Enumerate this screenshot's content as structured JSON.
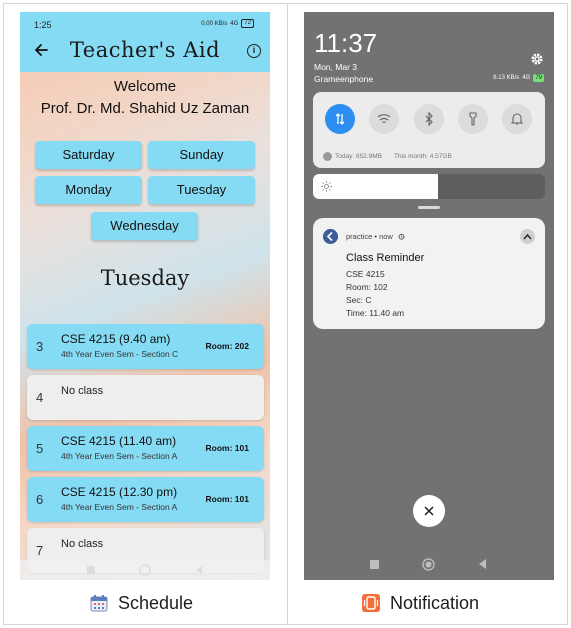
{
  "schedule_screen": {
    "status_time": "1:25",
    "status_net": "0.00 KB/s",
    "status_signal": "4G",
    "battery": "72",
    "app_title": "Teacher's Aid",
    "welcome": "Welcome",
    "teacher_name": "Prof. Dr. Md. Shahid Uz Zaman",
    "day_buttons": [
      "Saturday",
      "Sunday",
      "Monday",
      "Tuesday",
      "Wednesday"
    ],
    "selected_day": "Tuesday",
    "classes": [
      {
        "num": "3",
        "title": "CSE 4215 (9.40 am)",
        "sub": "4th Year Even Sem - Section C",
        "room": "Room: 202",
        "active": true
      },
      {
        "num": "4",
        "title": "No class",
        "sub": "",
        "room": "",
        "active": false
      },
      {
        "num": "5",
        "title": "CSE 4215 (11.40 am)",
        "sub": "4th Year Even Sem - Section A",
        "room": "Room: 101",
        "active": true
      },
      {
        "num": "6",
        "title": "CSE 4215 (12.30 pm)",
        "sub": "4th Year Even Sem - Section A",
        "room": "Room: 101",
        "active": true
      },
      {
        "num": "7",
        "title": "No class",
        "sub": "",
        "room": "",
        "active": false
      }
    ],
    "caption": "Schedule"
  },
  "notification_screen": {
    "time": "11:37",
    "date": "Mon, Mar 3",
    "carrier": "Grameenphone",
    "net_speed": "6.13 KB/s",
    "signal": "4G",
    "battery": "79",
    "usage_today": "Today: 652.9MB",
    "usage_month": "This month: 4.57GB",
    "brightness_level": 0.54,
    "notification": {
      "app": "practice",
      "when": "now",
      "title": "Class Reminder",
      "lines": [
        "CSE 4215",
        "Room: 102",
        "Sec: C",
        "Time: 11.40 am"
      ]
    },
    "caption": "Notification"
  },
  "colors": {
    "accent_cyan": "#86dbf4",
    "toggle_blue": "#2b8ef0",
    "shade_gray": "#727272"
  }
}
